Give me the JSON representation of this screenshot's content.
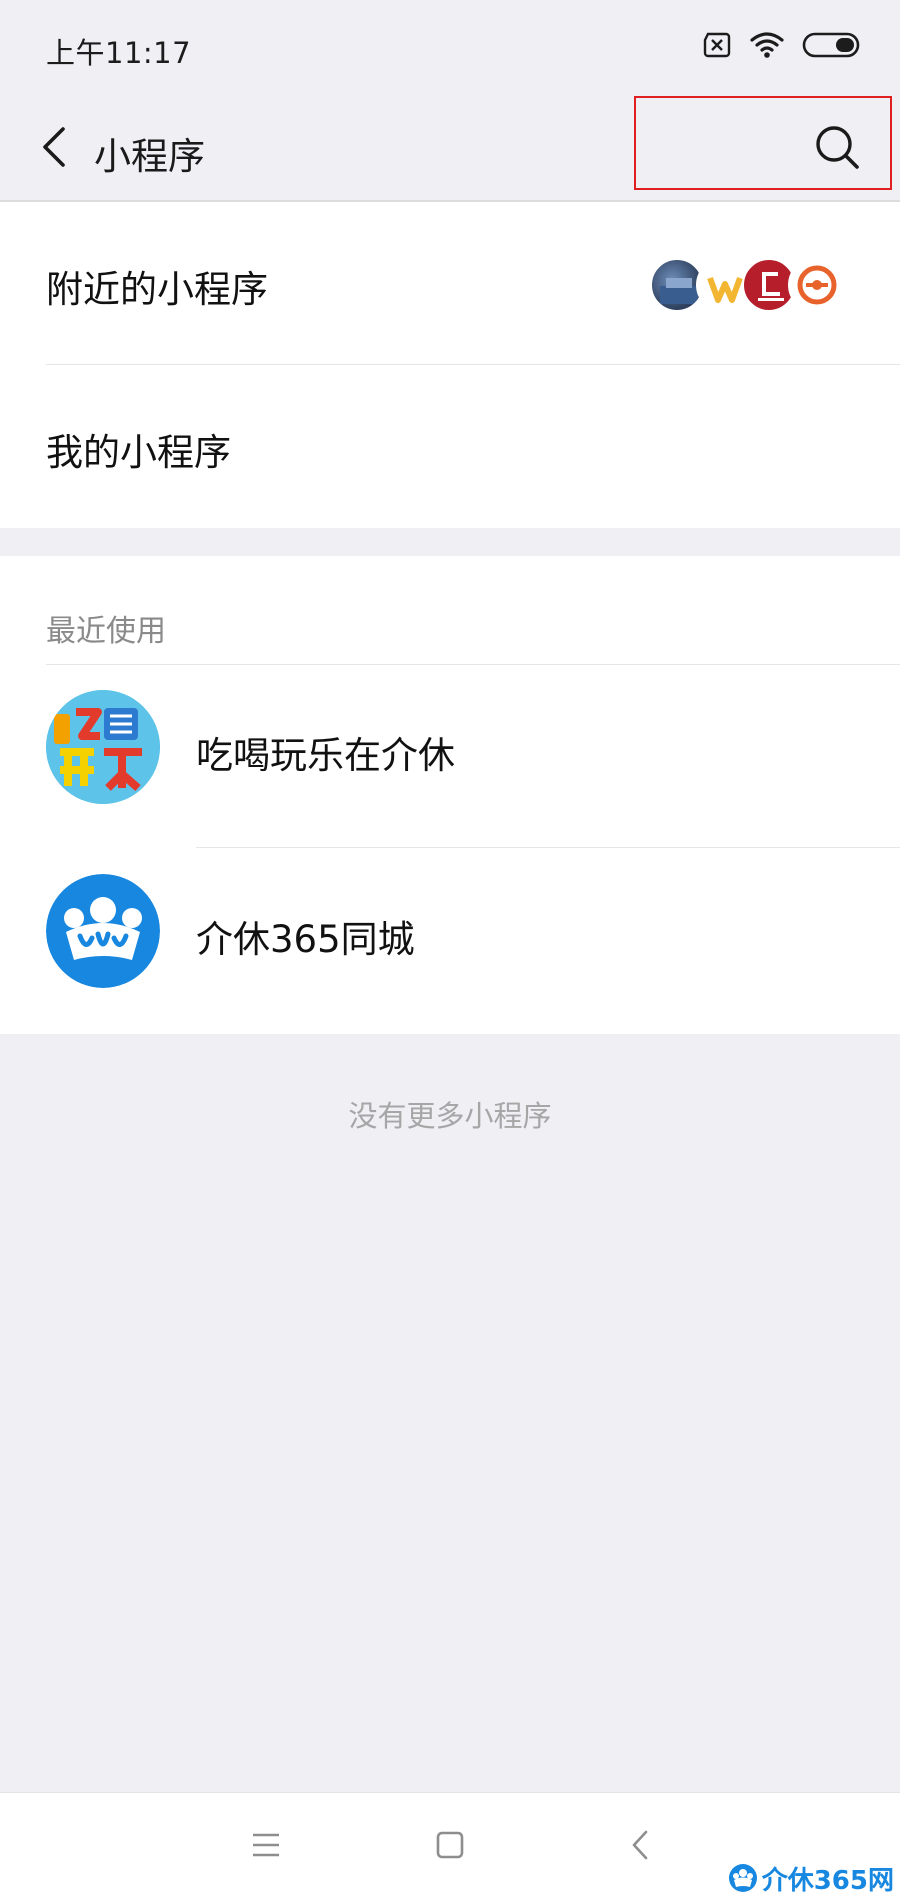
{
  "status_bar": {
    "time": "上午11:17",
    "icons": [
      "sim-error-icon",
      "wifi-icon",
      "battery-toggle-icon"
    ]
  },
  "header": {
    "back_icon": "chevron-left-icon",
    "title": "小程序",
    "search_icon": "search-icon",
    "highlight_color": "#e02020"
  },
  "menu": {
    "nearby_label": "附近的小程序",
    "mine_label": "我的小程序"
  },
  "recent": {
    "header": "最近使用",
    "items": [
      {
        "name": "吃喝玩乐在介休",
        "icon": "chihe-wanle-logo"
      },
      {
        "name": "介休365同城",
        "icon": "jiexiu365-crown-logo"
      }
    ]
  },
  "footer_note": "没有更多小程序",
  "nav_bar": {
    "icons": [
      "menu-icon",
      "home-icon",
      "back-icon"
    ]
  },
  "watermark": {
    "text": "介休365网"
  },
  "colors": {
    "page_bg": "#efeff4",
    "card_bg": "#ffffff",
    "brand_blue": "#1787e0"
  }
}
